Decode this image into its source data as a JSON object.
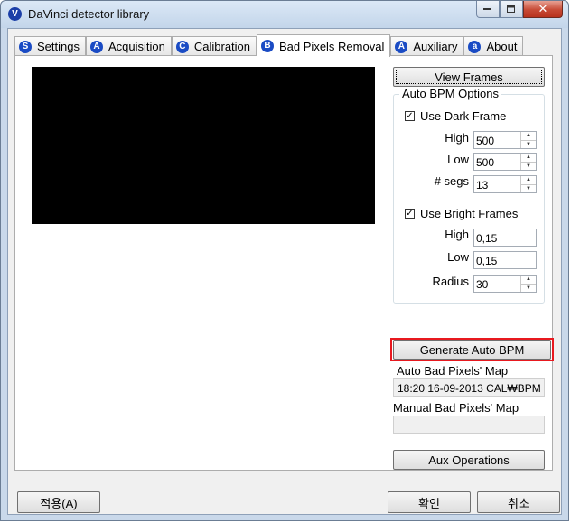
{
  "window": {
    "title": "DaVinci detector library",
    "app_icon_glyph": "V",
    "close_glyph": "✕"
  },
  "tabs": [
    {
      "icon_letter": "S",
      "label": "Settings"
    },
    {
      "icon_letter": "A",
      "label": "Acquisition"
    },
    {
      "icon_letter": "C",
      "label": "Calibration"
    },
    {
      "icon_letter": "B",
      "label": "Bad Pixels Removal"
    },
    {
      "icon_letter": "A",
      "label": "Auxiliary"
    },
    {
      "icon_letter": "a",
      "label": "About"
    }
  ],
  "active_tab": "Bad Pixels Removal",
  "view_frames_label": "View Frames",
  "auto_bpm": {
    "group_label": "Auto BPM Options",
    "dark": {
      "checkbox_label": "Use Dark Frame",
      "checked": true,
      "high_label": "High",
      "high_value": "500",
      "low_label": "Low",
      "low_value": "500",
      "segs_label": "# segs",
      "segs_value": "13"
    },
    "bright": {
      "checkbox_label": "Use Bright Frames",
      "checked": true,
      "high_label": "High",
      "high_value": "0,15",
      "low_label": "Low",
      "low_value": "0,15",
      "radius_label": "Radius",
      "radius_value": "30"
    }
  },
  "generate_label": "Generate Auto BPM",
  "auto_map": {
    "label": "Auto Bad Pixels' Map",
    "value": "18:20 16-09-2013 CAL₩BPM"
  },
  "manual_map": {
    "label": "Manual Bad Pixels' Map",
    "value": ""
  },
  "aux_ops_label": "Aux Operations",
  "footer": {
    "apply_label": "적용(A)",
    "ok_label": "확인",
    "cancel_label": "취소"
  },
  "colors": {
    "highlight": "#e8191f",
    "tab_icon": "#1a4bc4",
    "close_button": "#c74a35"
  }
}
